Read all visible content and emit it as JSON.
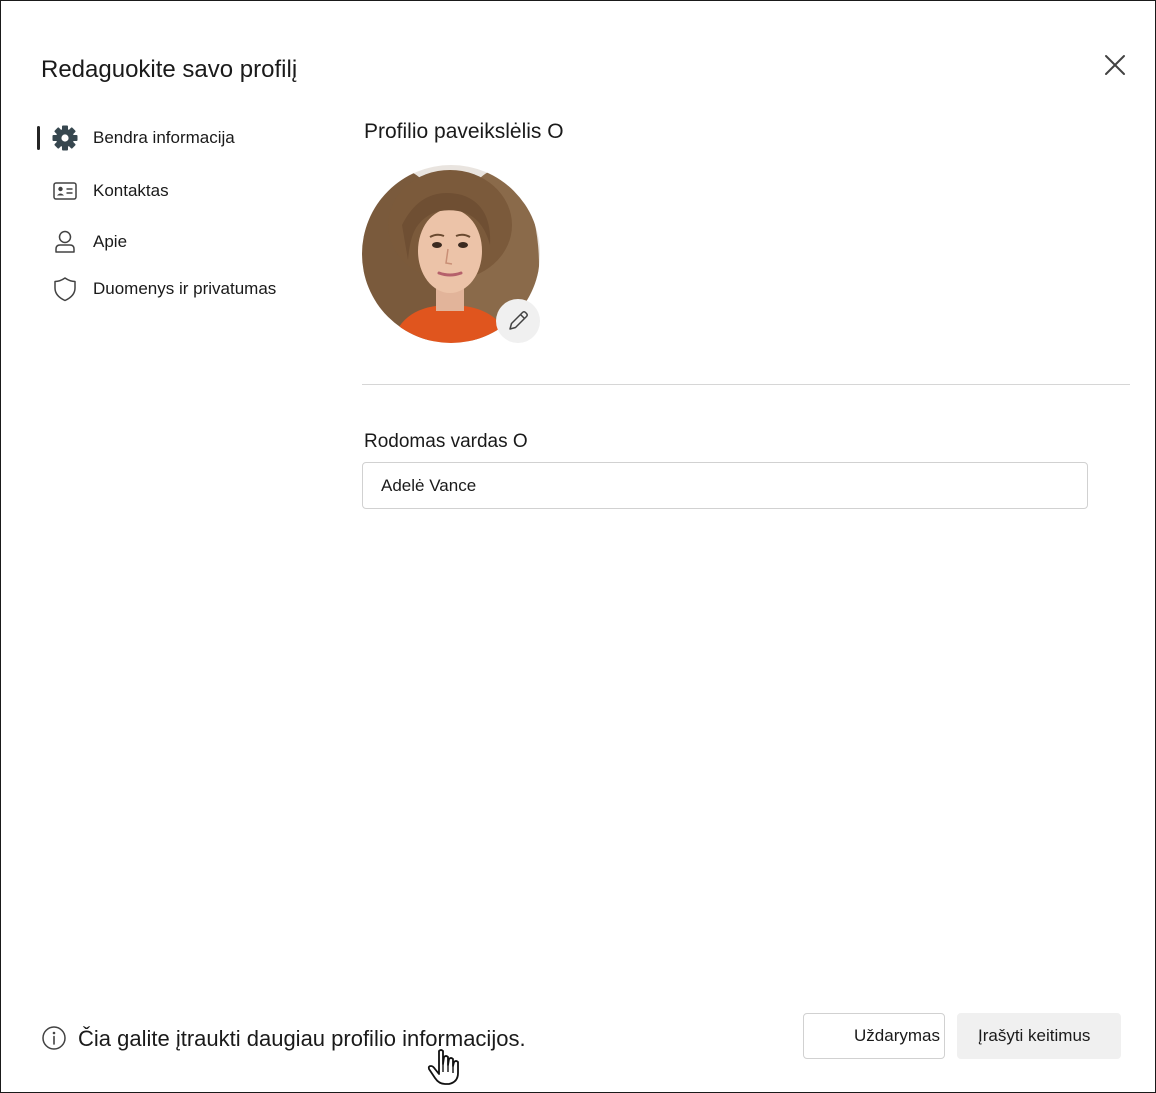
{
  "dialog": {
    "title": "Redaguokite savo profilį",
    "close_icon": "close-icon"
  },
  "sidebar": {
    "items": [
      {
        "label": "Bendra informacija",
        "icon": "gear-icon",
        "active": true
      },
      {
        "label": "Kontaktas",
        "icon": "contact-card-icon",
        "active": false
      },
      {
        "label": "Apie",
        "icon": "person-icon",
        "active": false
      },
      {
        "label": "Duomenys ir privatumas",
        "icon": "shield-icon",
        "active": false
      }
    ]
  },
  "main": {
    "photo_heading": "Profilio paveikslėlis O",
    "edit_photo_icon": "pencil-icon",
    "display_name_label": "Rodomas vardas O",
    "display_name_value": "Adelė Vance"
  },
  "footer": {
    "info_icon": "info-icon",
    "info_text": "Čia galite įtraukti daugiau profilio informacijos.",
    "close_button": "Uždarymas",
    "save_button": "Įrašyti keitimus"
  },
  "colors": {
    "text": "#242424",
    "border": "#d1d1d1",
    "secondary_button": "#f0f0f0",
    "divider": "#d6d6d6"
  }
}
